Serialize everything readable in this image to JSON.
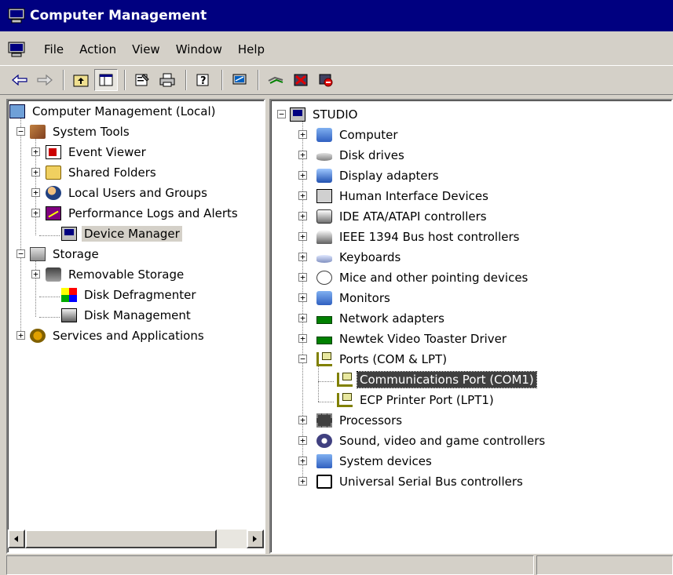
{
  "window": {
    "title": "Computer Management",
    "icon": "computer-management-icon"
  },
  "menu": {
    "items": [
      "File",
      "Action",
      "View",
      "Window",
      "Help"
    ]
  },
  "toolbar": {
    "buttons": [
      {
        "name": "back-button",
        "glyph": "⇦"
      },
      {
        "name": "forward-button",
        "glyph": "⇨"
      },
      {
        "name": "up-one-level-button",
        "glyph": "⤒"
      },
      {
        "name": "show-hide-console-tree-button",
        "glyph": "▥"
      },
      {
        "name": "properties-button",
        "glyph": "☑"
      },
      {
        "name": "print-button",
        "glyph": "⎙"
      },
      {
        "name": "help-button",
        "glyph": "?"
      },
      {
        "name": "scan-hardware-button",
        "glyph": "⊞"
      },
      {
        "name": "update-driver-button",
        "glyph": "≈"
      },
      {
        "name": "uninstall-button",
        "glyph": "✖"
      },
      {
        "name": "disable-button",
        "glyph": "⊘"
      }
    ]
  },
  "console_tree": {
    "items": [
      {
        "label": "Computer Management (Local)",
        "icon": "computer-icon"
      },
      {
        "label": "System Tools",
        "icon": "tools-icon"
      },
      {
        "label": "Event Viewer",
        "icon": "event-viewer-icon"
      },
      {
        "label": "Shared Folders",
        "icon": "shared-folders-icon"
      },
      {
        "label": "Local Users and Groups",
        "icon": "users-icon"
      },
      {
        "label": "Performance Logs and Alerts",
        "icon": "performance-icon"
      },
      {
        "label": "Device Manager",
        "icon": "device-manager-icon",
        "selected": true
      },
      {
        "label": "Storage",
        "icon": "storage-icon"
      },
      {
        "label": "Removable Storage",
        "icon": "removable-storage-icon"
      },
      {
        "label": "Disk Defragmenter",
        "icon": "defragmenter-icon"
      },
      {
        "label": "Disk Management",
        "icon": "disk-management-icon"
      },
      {
        "label": "Services and Applications",
        "icon": "services-icon"
      }
    ]
  },
  "device_tree": {
    "root": "STUDIO",
    "items": [
      {
        "label": "Computer",
        "icon": "computer-icon"
      },
      {
        "label": "Disk drives",
        "icon": "disk-drive-icon"
      },
      {
        "label": "Display adapters",
        "icon": "display-adapter-icon"
      },
      {
        "label": "Human Interface Devices",
        "icon": "hid-icon"
      },
      {
        "label": "IDE ATA/ATAPI controllers",
        "icon": "ide-controller-icon"
      },
      {
        "label": "IEEE 1394 Bus host controllers",
        "icon": "ieee1394-icon"
      },
      {
        "label": "Keyboards",
        "icon": "keyboard-icon"
      },
      {
        "label": "Mice and other pointing devices",
        "icon": "mouse-icon"
      },
      {
        "label": "Monitors",
        "icon": "monitor-icon"
      },
      {
        "label": "Network adapters",
        "icon": "network-adapter-icon"
      },
      {
        "label": "Newtek Video Toaster Driver",
        "icon": "network-adapter-icon"
      },
      {
        "label": "Ports (COM & LPT)",
        "icon": "port-icon"
      },
      {
        "label": "Communications Port (COM1)",
        "icon": "port-icon",
        "selected": true
      },
      {
        "label": "ECP Printer Port (LPT1)",
        "icon": "port-icon"
      },
      {
        "label": "Processors",
        "icon": "processor-icon"
      },
      {
        "label": "Sound, video and game controllers",
        "icon": "sound-icon"
      },
      {
        "label": "System devices",
        "icon": "system-devices-icon"
      },
      {
        "label": "Universal Serial Bus controllers",
        "icon": "usb-icon"
      }
    ]
  },
  "statusbar": {
    "left_text": "",
    "right_text": ""
  }
}
